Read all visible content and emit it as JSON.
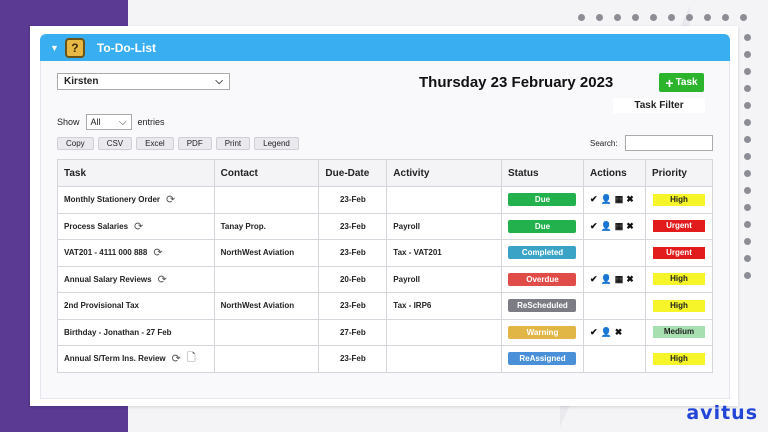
{
  "colors": {
    "header": "#39aef0",
    "status": {
      "Due": "#22b14c",
      "Completed": "#3aa3c6",
      "Overdue": "#e04c47",
      "ReScheduled": "#7c7c84",
      "Warning": "#e2b646",
      "ReAssigned": "#4a90d9"
    },
    "priority": {
      "High": "#f5f52a",
      "Urgent": "#e21c1c",
      "Medium": "#a8dfb0"
    }
  },
  "header": {
    "title": "To-Do-List"
  },
  "user_select": {
    "value": "Kirsten"
  },
  "date_title": "Thursday 23 February 2023",
  "task_button": {
    "label": "Task"
  },
  "task_filter": {
    "label": "Task Filter"
  },
  "show_entries": {
    "prefix": "Show",
    "value": "All",
    "suffix": "entries"
  },
  "export_buttons": [
    "Copy",
    "CSV",
    "Excel",
    "PDF",
    "Print",
    "Legend"
  ],
  "search": {
    "label": "Search:",
    "value": ""
  },
  "table": {
    "headers": [
      "Task",
      "Contact",
      "Due-Date",
      "Activity",
      "Status",
      "Actions",
      "Priority"
    ],
    "rows": [
      {
        "task": "Monthly Stationery Order",
        "contact": "",
        "due": "23-Feb",
        "activity": "",
        "status": "Due",
        "priority": "High"
      },
      {
        "task": "Process Salaries",
        "contact": "Tanay Prop.",
        "due": "23-Feb",
        "activity": "Payroll",
        "status": "Due",
        "priority": "Urgent"
      },
      {
        "task": "VAT201 - 4111 000 888",
        "contact": "NorthWest Aviation",
        "due": "23-Feb",
        "activity": "Tax - VAT201",
        "status": "Completed",
        "priority": "Urgent"
      },
      {
        "task": "Annual Salary Reviews",
        "contact": "",
        "due": "20-Feb",
        "activity": "Payroll",
        "status": "Overdue",
        "priority": "High"
      },
      {
        "task": "2nd Provisional Tax",
        "contact": "NorthWest Aviation",
        "due": "23-Feb",
        "activity": "Tax - IRP6",
        "status": "ReScheduled",
        "priority": "High"
      },
      {
        "task": "Birthday - Jonathan - 27 Feb",
        "contact": "",
        "due": "27-Feb",
        "activity": "",
        "status": "Warning",
        "priority": "Medium"
      },
      {
        "task": "Annual S/Term Ins. Review",
        "contact": "",
        "due": "23-Feb",
        "activity": "",
        "status": "ReAssigned",
        "priority": "High"
      }
    ]
  },
  "row_icons": [
    [
      "refresh-icon"
    ],
    [
      "refresh-icon"
    ],
    [
      "refresh-icon"
    ],
    [
      "refresh-icon"
    ],
    [],
    [],
    [
      "refresh-icon",
      "document-icon"
    ]
  ],
  "row_actions": [
    [
      "check-icon",
      "person-icon",
      "calendar-icon",
      "close-icon"
    ],
    [
      "check-icon",
      "person-icon",
      "calendar-icon",
      "close-icon"
    ],
    [],
    [
      "check-icon",
      "person-icon",
      "calendar-icon",
      "close-icon"
    ],
    [],
    [
      "check-icon",
      "person-icon",
      "close-icon"
    ],
    []
  ],
  "brand": "avitus"
}
